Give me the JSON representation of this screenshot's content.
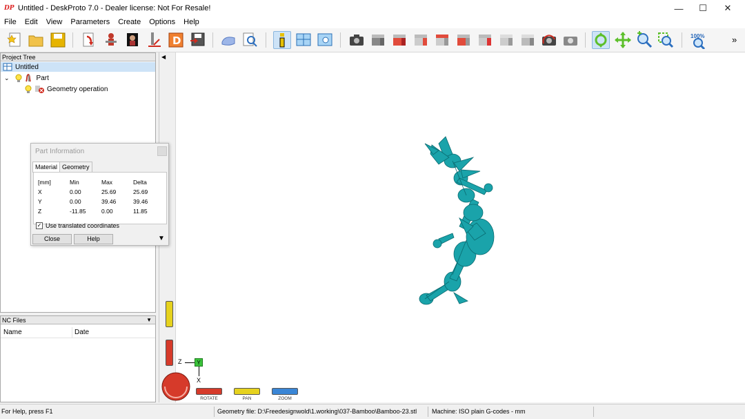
{
  "window": {
    "logo_text": "DP",
    "title": "Untitled - DeskProto 7.0 - Dealer license: Not For Resale!",
    "minimize": "—",
    "maximize": "☐",
    "close": "✕"
  },
  "menu": [
    "File",
    "Edit",
    "View",
    "Parameters",
    "Create",
    "Options",
    "Help"
  ],
  "toolbar": {
    "zoom_label": "100%",
    "overflow": "»"
  },
  "project_tree": {
    "header": "Project Tree",
    "items": [
      {
        "label": "Untitled"
      },
      {
        "label": "Part"
      },
      {
        "label": "Geometry operation"
      }
    ]
  },
  "part_info": {
    "title": "Part Information",
    "tabs": [
      "Material",
      "Geometry"
    ],
    "headers": [
      "[mm]",
      "Min",
      "Max",
      "Delta"
    ],
    "rows": [
      [
        "X",
        "0.00",
        "25.69",
        "25.69"
      ],
      [
        "Y",
        "0.00",
        "39.46",
        "39.46"
      ],
      [
        "Z",
        "-11.85",
        "0.00",
        "11.85"
      ]
    ],
    "checkbox_label": "Use translated coordinates",
    "close_label": "Close",
    "help_label": "Help"
  },
  "nc_files": {
    "header": "NC Files",
    "columns": [
      "Name",
      "Date"
    ]
  },
  "viewport": {
    "axis_z": "Z",
    "axis_y": "Y",
    "axis_x": "X",
    "nav": [
      "ROTATE",
      "PAN",
      "ZOOM"
    ]
  },
  "status": {
    "help": "For Help, press F1",
    "geometry_file": "Geometry file: D:\\Freedesignwold\\1.working\\037-Bamboo\\Bamboo-23.stl",
    "machine": "Machine: ISO plain G-codes - mm"
  },
  "colors": {
    "model": "#1aa3aa",
    "selection": "#cde3f7",
    "rotate": "#d63a2a",
    "pan": "#e6d21e",
    "zoom": "#3a86d6"
  }
}
